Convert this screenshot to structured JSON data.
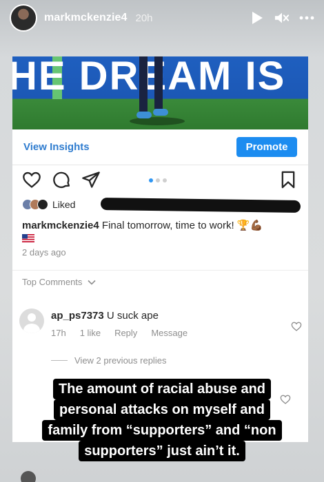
{
  "story": {
    "username": "markmckenzie4",
    "time": "20h",
    "icons": [
      "play-icon",
      "mute-icon",
      "more-icon"
    ]
  },
  "post": {
    "banner_text": "HE DREAM IS",
    "view_insights": "View Insights",
    "promote": "Promote",
    "carousel": {
      "total": 3,
      "active": 1
    },
    "liked_prefix": "Liked",
    "caption_user": "markmckenzie4",
    "caption_text": " Final tomorrow, time to work! 🏆💪🏾",
    "posted_ago": "2 days ago",
    "top_comments_label": "Top Comments",
    "comment": {
      "username": "ap_ps7373",
      "text": " U suck ape",
      "time": "17h",
      "likes": "1 like",
      "reply": "Reply",
      "message": "Message"
    },
    "view_replies": "View 2 previous replies"
  },
  "overlay": {
    "lines": [
      "The amount of racial abuse and",
      "personal attacks on myself and",
      "family from “supporters” and “non",
      "supporters” just ain’t it."
    ]
  },
  "colors": {
    "accent_blue": "#1c8cf0",
    "link_blue": "#2f7ccf",
    "banner_blue": "#1f5fbf"
  }
}
